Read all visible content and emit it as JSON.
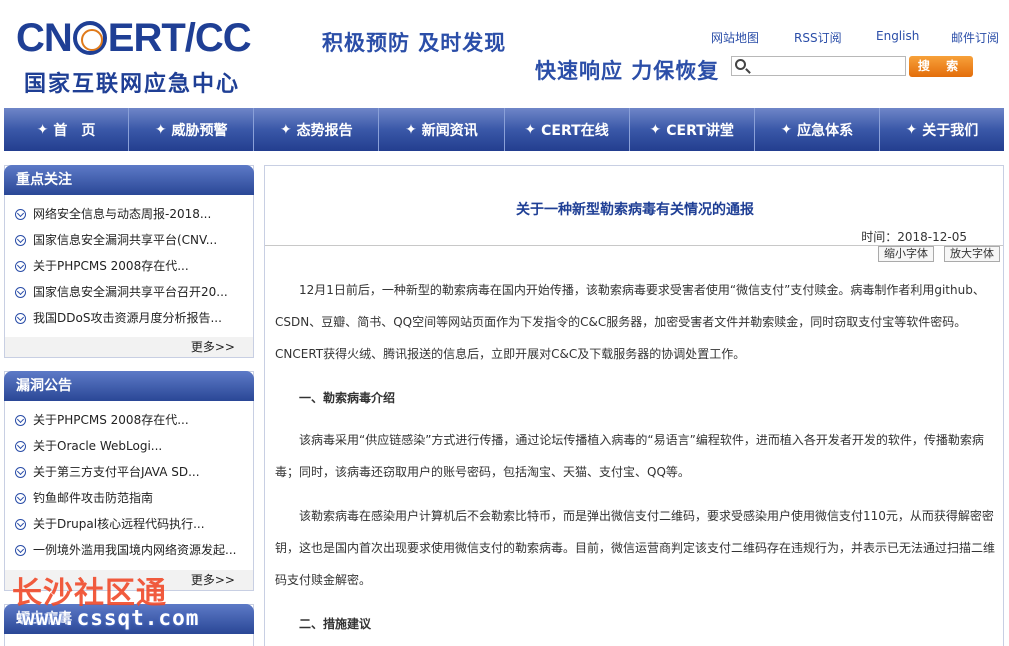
{
  "header": {
    "logo_en_1": "CN",
    "logo_en_2": "ERT/CC",
    "logo_cn": "国家互联网应急中心",
    "slogan1": "积极预防 及时发现",
    "slogan2": "快速响应 力保恢复",
    "links": [
      "网站地图",
      "RSS订阅",
      "English",
      "邮件订阅"
    ],
    "search_value": "",
    "search_button": "搜 索"
  },
  "nav": {
    "items": [
      "首　页",
      "威胁预警",
      "态势报告",
      "新闻资讯",
      "CERT在线",
      "CERT讲堂",
      "应急体系",
      "关于我们"
    ]
  },
  "sidebar": {
    "focus": {
      "title": "重点关注",
      "items": [
        "网络安全信息与动态周报-2018...",
        "国家信息安全漏洞共享平台(CNV...",
        "关于PHPCMS 2008存在代...",
        "国家信息安全漏洞共享平台召开20...",
        "我国DDoS攻击资源月度分析报告..."
      ],
      "more": "更多>>"
    },
    "vuln": {
      "title": "漏洞公告",
      "items": [
        "关于PHPCMS 2008存在代...",
        "关于Oracle WebLogi...",
        "关于第三方支付平台JAVA SD...",
        "钓鱼邮件攻击防范指南",
        "关于Drupal核心远程代码执行...",
        "一例境外滥用我国境内网络资源发起..."
      ],
      "more": "更多>>"
    },
    "third": {
      "title": "蠕虫病毒"
    }
  },
  "article": {
    "title": "关于一种新型勒索病毒有关情况的通报",
    "time": "时间：2018-12-05",
    "font_small": "缩小字体",
    "font_large": "放大字体",
    "paragraphs": [
      "12月1日前后，一种新型的勒索病毒在国内开始传播，该勒索病毒要求受害者使用“微信支付”支付赎金。病毒制作者利用github、CSDN、豆瓣、简书、QQ空间等网站页面作为下发指令的C&C服务器，加密受害者文件并勒索赎金，同时窃取支付宝等软件密码。CNCERT获得火绒、腾讯报送的信息后，立即开展对C&C及下载服务器的协调处置工作。",
      "一、勒索病毒介绍",
      "该病毒采用“供应链感染”方式进行传播，通过论坛传播植入病毒的“易语言”编程软件，进而植入各开发者开发的软件，传播勒索病毒；同时，该病毒还窃取用户的账号密码，包括淘宝、天猫、支付宝、QQ等。",
      "该勒索病毒在感染用户计算机后不会勒索比特币，而是弹出微信支付二维码，要求受感染用户使用微信支付110元，从而获得解密密钥，这也是国内首次出现要求使用微信支付的勒索病毒。目前，微信运营商判定该支付二维码存在违规行为，并表示已无法通过扫描二维码支付赎金解密。",
      "二、措施建议"
    ]
  },
  "watermark": {
    "cn": "长沙社区通",
    "url": "www.cssqt.com"
  }
}
